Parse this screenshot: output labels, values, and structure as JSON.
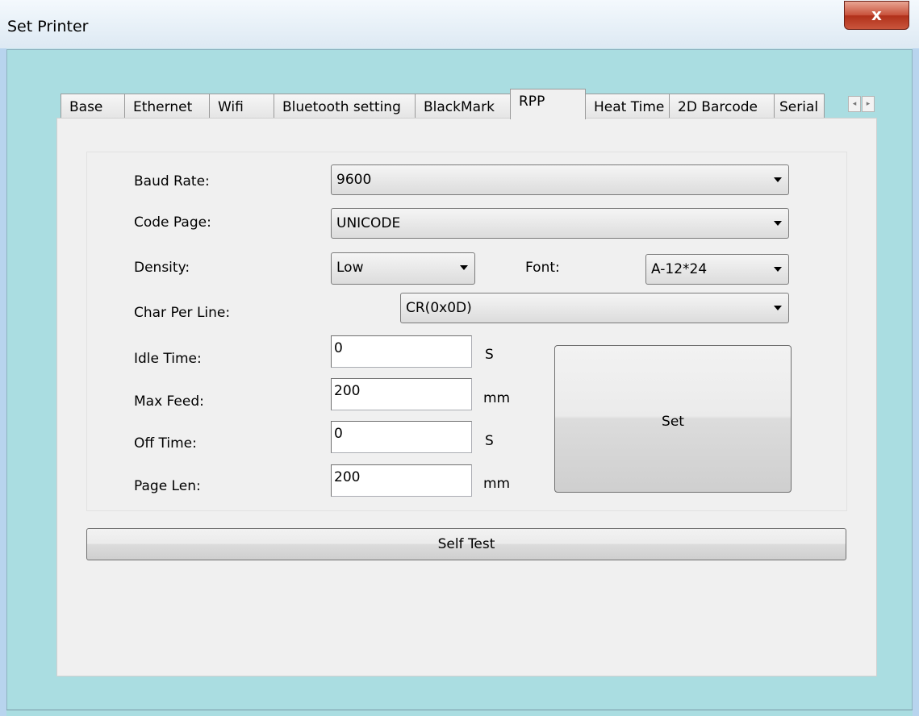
{
  "window": {
    "title": "Set Printer",
    "close_glyph": "x"
  },
  "tabs": [
    {
      "label": "Base"
    },
    {
      "label": "Ethernet"
    },
    {
      "label": "Wifi"
    },
    {
      "label": "Bluetooth setting"
    },
    {
      "label": "BlackMark"
    },
    {
      "label": "RPP",
      "active": true
    },
    {
      "label": "Heat Time"
    },
    {
      "label": "2D Barcode"
    },
    {
      "label": "Serial"
    }
  ],
  "tab_scroll": {
    "left": "◂",
    "right": "▸"
  },
  "form": {
    "baud_rate": {
      "label": "Baud Rate:",
      "value": "9600"
    },
    "code_page": {
      "label": "Code Page:",
      "value": "UNICODE"
    },
    "density": {
      "label": "Density:",
      "value": "Low"
    },
    "font": {
      "label": "Font:",
      "value": "A-12*24"
    },
    "char_per_line": {
      "label": "Char Per Line:",
      "value": "CR(0x0D)"
    },
    "idle_time": {
      "label": "Idle Time:",
      "value": "0",
      "unit": "S"
    },
    "max_feed": {
      "label": "Max Feed:",
      "value": "200",
      "unit": "mm"
    },
    "off_time": {
      "label": "Off Time:",
      "value": "0",
      "unit": "S"
    },
    "page_len": {
      "label": "Page Len:",
      "value": "200",
      "unit": "mm"
    }
  },
  "buttons": {
    "set": "Set",
    "self_test": "Self Test"
  }
}
